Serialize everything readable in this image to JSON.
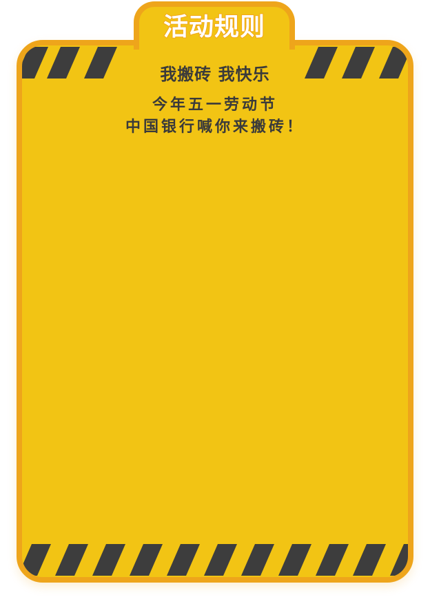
{
  "header": {
    "title": "活动规则"
  },
  "panel": {
    "slogan": "我搬砖 我快乐",
    "lines": [
      "今年五一劳动节",
      "中国银行喊你来搬砖！"
    ]
  },
  "colors": {
    "panel_fill": "#f2c414",
    "panel_border": "#eea51b",
    "stripe_dark": "#3d3d3d",
    "text": "#3a3a3a",
    "title": "#ffffff"
  }
}
